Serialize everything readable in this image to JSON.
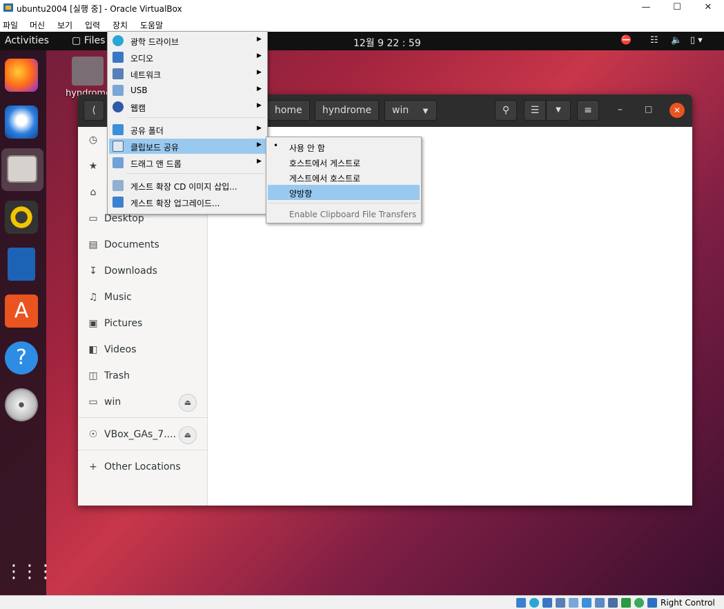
{
  "window": {
    "title": "ubuntu2004 [실행 중] - Oracle VirtualBox"
  },
  "vb_menu": [
    "파일",
    "머신",
    "보기",
    "입력",
    "장치",
    "도움말"
  ],
  "gnome": {
    "activities": "Activities",
    "app_menu": "Files",
    "clock": "12월 9  22 : 59"
  },
  "desktop": {
    "home_label": "hyndrome"
  },
  "files": {
    "breadcrumbs": [
      "home",
      "hyndrome",
      "win"
    ],
    "sidebar": [
      {
        "label": "Desktop",
        "icon": "desktop-icon"
      },
      {
        "label": "Documents",
        "icon": "documents-icon"
      },
      {
        "label": "Downloads",
        "icon": "downloads-icon"
      },
      {
        "label": "Music",
        "icon": "music-icon"
      },
      {
        "label": "Pictures",
        "icon": "pictures-icon"
      },
      {
        "label": "Videos",
        "icon": "videos-icon"
      },
      {
        "label": "Trash",
        "icon": "trash-icon"
      },
      {
        "label": "win",
        "icon": "drive-icon"
      }
    ],
    "device": "VBox_GAs_7....",
    "other_locations": "Other Locations"
  },
  "devices_menu": {
    "items": [
      {
        "label": "광학 드라이브",
        "submenu": true
      },
      {
        "label": "오디오",
        "submenu": true
      },
      {
        "label": "네트워크",
        "submenu": true
      },
      {
        "label": "USB",
        "submenu": true
      },
      {
        "label": "웹캠",
        "submenu": true
      },
      {
        "label": "공유 폴더",
        "submenu": true
      },
      {
        "label": "클립보드 공유",
        "submenu": true,
        "highlighted": true
      },
      {
        "label": "드래그 앤 드롭",
        "submenu": true
      },
      {
        "label": "게스트 확장 CD 이미지 삽입..."
      },
      {
        "label": "게스트 확장 업그레이드..."
      }
    ]
  },
  "clipboard_submenu": {
    "items": [
      {
        "label": "사용 안 함",
        "checked": true
      },
      {
        "label": "호스트에서 게스트로"
      },
      {
        "label": "게스트에서 호스트로"
      },
      {
        "label": "양방향",
        "highlighted": true
      }
    ],
    "disabled_item": "Enable Clipboard File Transfers"
  },
  "statusbar": {
    "host_key": "Right Control"
  },
  "colors": {
    "highlight": "#99c9ef",
    "ubuntu_close": "#e95420"
  }
}
